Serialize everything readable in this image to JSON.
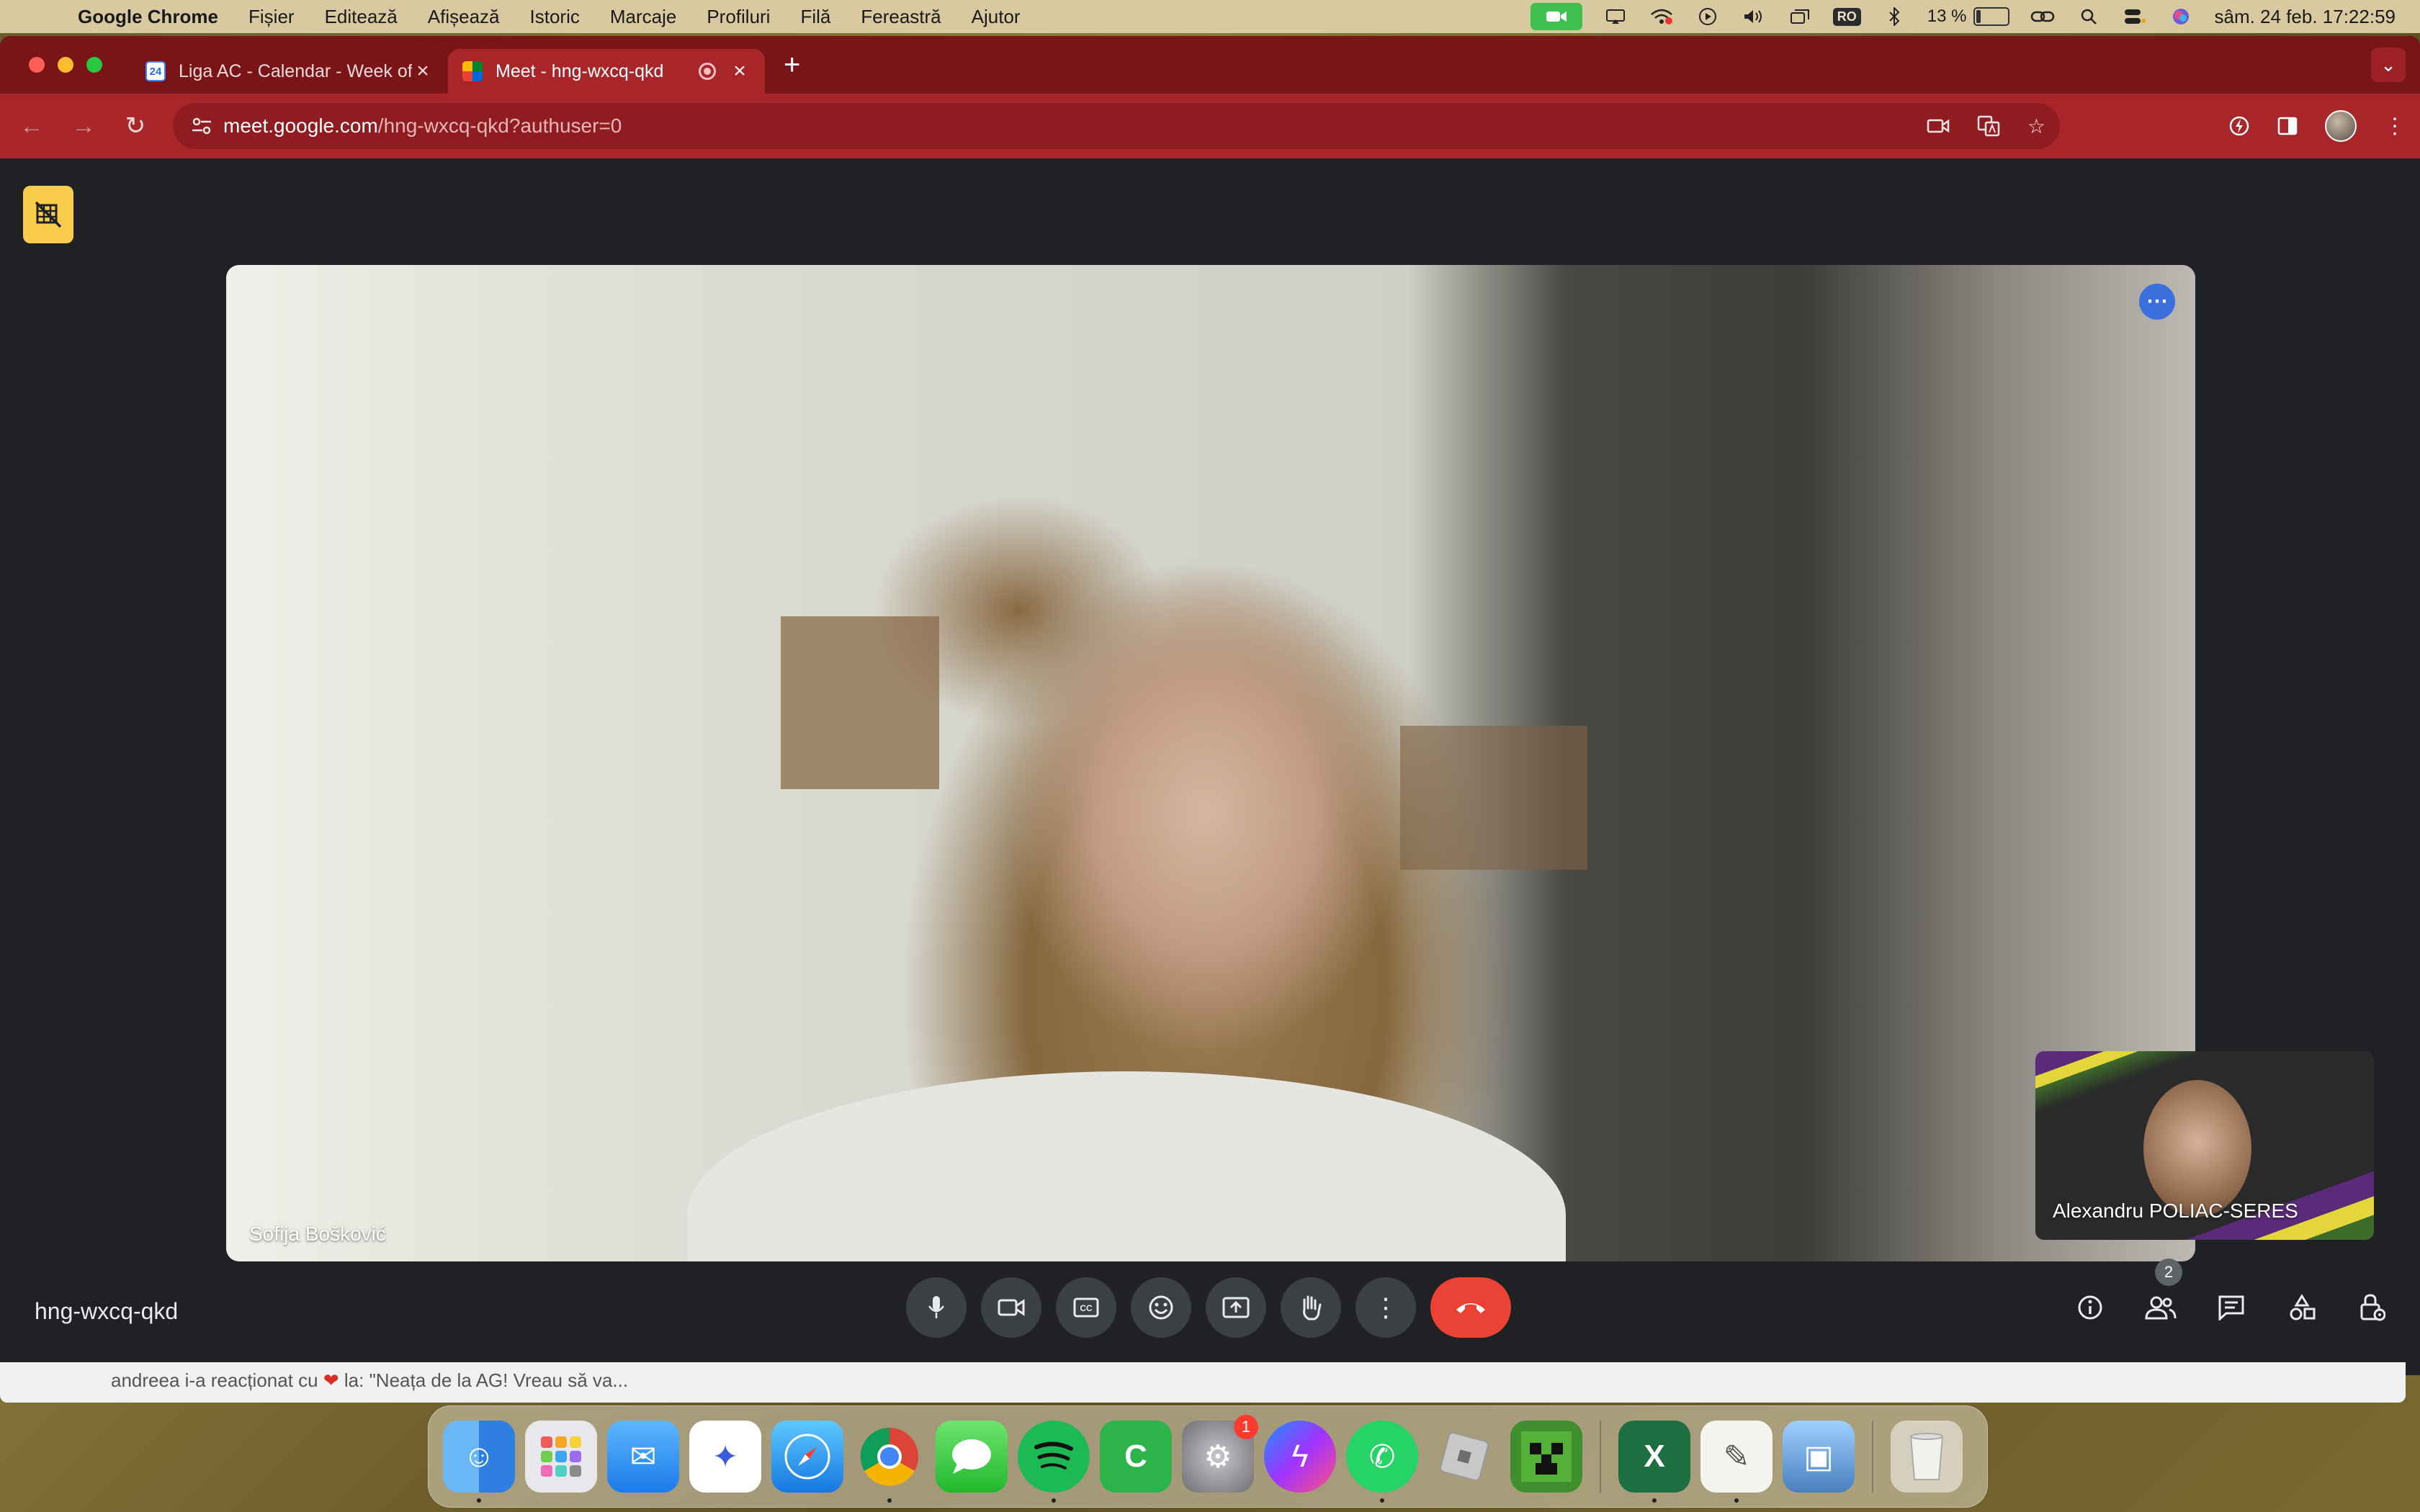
{
  "menubar": {
    "app_name": "Google Chrome",
    "items": [
      "Fișier",
      "Editează",
      "Afișează",
      "Istoric",
      "Marcaje",
      "Profiluri",
      "Filă",
      "Fereastră",
      "Ajutor"
    ],
    "input_source": "RO",
    "battery_percent": "13 %",
    "battery_level": 0.13,
    "datetime": "sâm. 24 feb.  17:22:59"
  },
  "tabs": [
    {
      "title": "Liga AC - Calendar - Week of",
      "favicon": "calendar-icon",
      "favicon_text": "24"
    },
    {
      "title": "Meet - hng-wxcq-qkd",
      "favicon": "meet-icon"
    }
  ],
  "omnibox": {
    "host": "meet.google.com",
    "path": "/hng-wxcq-qkd?authuser=0"
  },
  "meet": {
    "main_participant": "Sofija Bošković",
    "self_participant": "Alexandru POLIAC-SERES",
    "meeting_code": "hng-wxcq-qkd",
    "people_count": "2"
  },
  "notification": {
    "prefix": "andreea i-a reacționat cu",
    "suffix": "la: \"Neața de la AG! Vreau să va..."
  },
  "dock": {
    "apps": [
      "finder-icon",
      "launchpad-icon",
      "mail-icon",
      "affinity-icon",
      "safari-icon",
      "chrome-icon",
      "messages-icon",
      "spotify-icon",
      "codeblocks-icon",
      "system-settings-icon",
      "messenger-icon",
      "whatsapp-icon",
      "roblox-icon",
      "minecraft-icon",
      "excel-icon",
      "textedit-icon",
      "preview-icon",
      "trash-icon"
    ],
    "settings_badge": "1"
  },
  "colors": {
    "tabstrip": "#7a1517",
    "toolbar": "#a8262a",
    "meet_bg": "#202124",
    "end_call": "#ea4335",
    "layout_button": "#f9cc4b"
  }
}
